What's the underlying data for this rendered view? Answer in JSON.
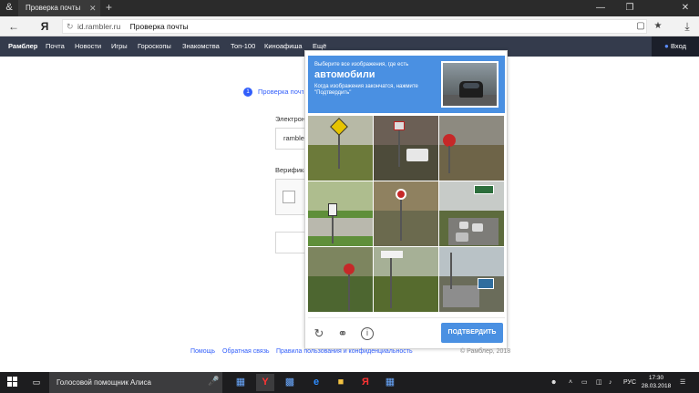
{
  "browser": {
    "tab_title": "Проверка почты",
    "tab_close": "✕",
    "new_tab": "+",
    "url_domain": "id.rambler.ru",
    "url_title": "Проверка почты",
    "window_controls": [
      "—",
      "❐",
      "✕"
    ]
  },
  "nav": {
    "items": [
      "Рамблер",
      "Почта",
      "Новости",
      "Игры",
      "Гороскопы",
      "Знакомства",
      "Топ-100",
      "Кинoафиша",
      "Ещё"
    ],
    "login": "Вход"
  },
  "page": {
    "step_number": "1",
    "step_label": "Проверка почты",
    "email_label": "Электронная почта",
    "email_value": "rambler",
    "verify_label": "Верификация"
  },
  "captcha": {
    "instruction": "Выберите все изображения, где есть",
    "keyword": "автомобили",
    "note": "Когда изображения закончатся, нажмите \"Подтвердить\"",
    "verify_button": "ПОДТВЕРДИТЬ",
    "icons": [
      "reload-icon",
      "headphones-icon",
      "info-icon"
    ],
    "accent_color": "#4a90e2",
    "tiles": [
      {
        "id": 1,
        "desc": "pedestrian-sign"
      },
      {
        "id": 2,
        "desc": "street-signs-car"
      },
      {
        "id": 3,
        "desc": "stop-sign"
      },
      {
        "id": 4,
        "desc": "no-right-turn-sign"
      },
      {
        "id": 5,
        "desc": "no-entry-sign"
      },
      {
        "id": 6,
        "desc": "highway-traffic"
      },
      {
        "id": 7,
        "desc": "stop-sign-trees"
      },
      {
        "id": 8,
        "desc": "roadside-sign-trees"
      },
      {
        "id": 9,
        "desc": "road-green-sign"
      }
    ]
  },
  "footer": {
    "help": "Помощь",
    "feedback": "Обратная связь",
    "terms": "Правила пользования и конфиденциальность",
    "copyright": "© Рамблер, 2018"
  },
  "taskbar": {
    "search_text": "Голосовой помощник Алиса",
    "lang": "РУС",
    "time": "17:30",
    "date": "28.03.2018"
  }
}
